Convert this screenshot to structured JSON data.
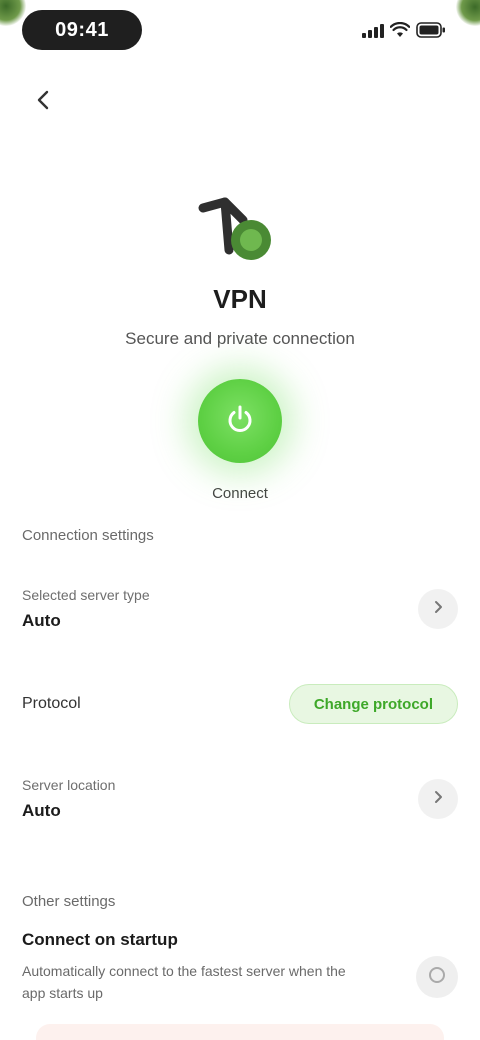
{
  "status_bar": {
    "time": "09:41"
  },
  "nav": {
    "back_icon": "back-arrow-icon"
  },
  "hero": {
    "app_name": "VPN",
    "subtitle": "Secure and private connection",
    "power_icon": "power-icon",
    "status_text": "Connect"
  },
  "settings": {
    "section_title": "Connection settings",
    "server": {
      "label": "Selected server type",
      "value": "Auto"
    },
    "protocol": {
      "label": "Protocol",
      "button_label": "Change protocol"
    },
    "location": {
      "label": "Server location",
      "value": "Auto"
    },
    "section2_title": "Other settings",
    "feature": {
      "title": "Connect on startup",
      "description": "Automatically connect to the fastest server when the app starts up"
    }
  },
  "colors": {
    "accent": "#5ed044",
    "accent_text": "#3ea829",
    "background": "#ffffff"
  }
}
